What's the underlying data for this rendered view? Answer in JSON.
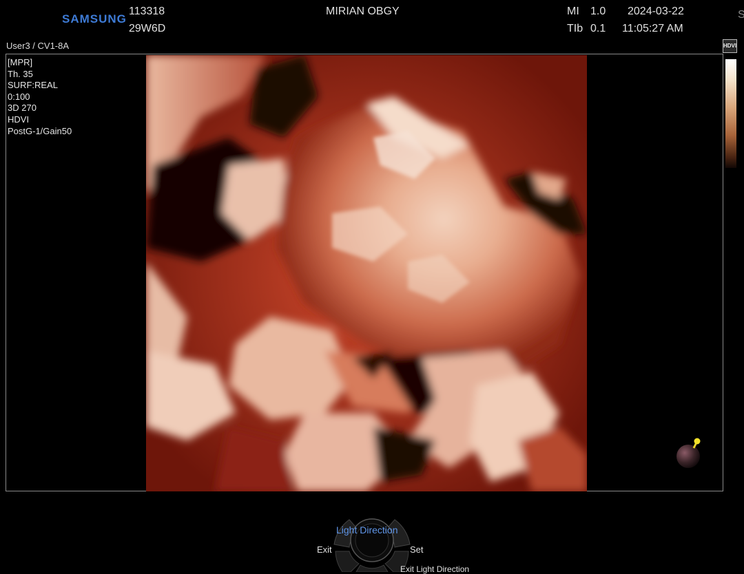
{
  "header": {
    "brand": "SAMSUNG",
    "patient_id": "113318",
    "gestational_age": "29W6D",
    "institution": "MIRIAN OBGY",
    "mi_label": "MI",
    "mi_value": "1.0",
    "tib_label": "TIb",
    "tib_value": "0.1",
    "date": "2024-03-22",
    "time": "11:05:27 AM",
    "right_edge_letter": "S",
    "preset": "User3 / CV1-8A"
  },
  "side_info": {
    "lines": [
      "[MPR]",
      "Th. 35",
      "SURF:REAL",
      "0:100",
      "3D 270",
      "HDVI",
      "PostG-1/Gain50"
    ]
  },
  "scale_badge": "HDVI",
  "controls": {
    "light_direction": "Light Direction",
    "exit": "Exit",
    "set": "Set",
    "exit_light_direction": "Exit Light Direction"
  },
  "colors": {
    "brand": "#3e7bd6",
    "highlight_label": "#5f95e8",
    "light_indicator": "#f2e12a"
  }
}
